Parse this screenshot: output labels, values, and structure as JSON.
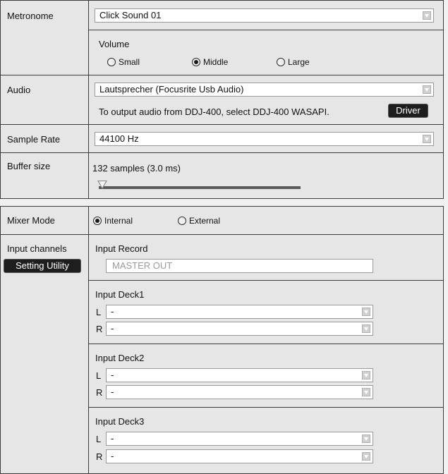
{
  "metronome": {
    "label": "Metronome",
    "sound": "Click Sound 01",
    "volume_label": "Volume",
    "options": [
      "Small",
      "Middle",
      "Large"
    ],
    "selected": "Middle"
  },
  "audio": {
    "label": "Audio",
    "device": "Lautsprecher (Focusrite Usb Audio)",
    "hint": "To output audio from DDJ-400, select DDJ-400 WASAPI.",
    "driver_label": "Driver"
  },
  "sample_rate": {
    "label": "Sample Rate",
    "value": "44100 Hz"
  },
  "buffer": {
    "label": "Buffer size",
    "value": "132 samples (3.0 ms)",
    "slider_position": 0
  },
  "mixer_mode": {
    "label": "Mixer Mode",
    "options": [
      "Internal",
      "External"
    ],
    "selected": "Internal"
  },
  "input_channels": {
    "label": "Input channels",
    "setting_utility_label": "Setting Utility",
    "record": {
      "title": "Input Record",
      "placeholder": "MASTER OUT"
    },
    "decks": [
      {
        "title": "Input Deck1",
        "l_label": "L",
        "l_value": "-",
        "r_label": "R",
        "r_value": "-"
      },
      {
        "title": "Input Deck2",
        "l_label": "L",
        "l_value": "-",
        "r_label": "R",
        "r_value": "-"
      },
      {
        "title": "Input Deck3",
        "l_label": "L",
        "l_value": "-",
        "r_label": "R",
        "r_value": "-"
      }
    ]
  },
  "colors": {
    "panel_bg": "#e6e6e6",
    "border": "#3c3c3c",
    "button_bg": "#1e1e1e"
  }
}
